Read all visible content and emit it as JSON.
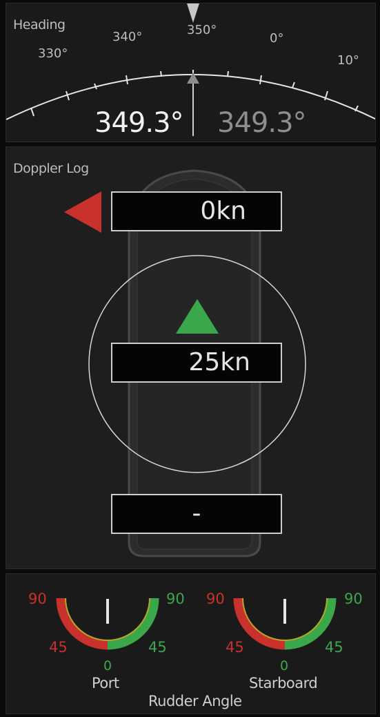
{
  "heading": {
    "title": "Heading",
    "ticks": [
      "330°",
      "340°",
      "350°",
      "0°",
      "10°"
    ],
    "value": "349.3°",
    "secondary_value": "349.3°"
  },
  "doppler": {
    "title": "Doppler Log",
    "transverse_speed": "0kn",
    "longitudinal_speed": "25kn",
    "aft_speed": "-"
  },
  "rudder": {
    "title": "Rudder Angle",
    "port": {
      "label": "Port",
      "left_top": "90",
      "left_mid": "45",
      "right_top": "90",
      "right_mid": "45",
      "bottom": "0"
    },
    "starboard": {
      "label": "Starboard",
      "left_top": "90",
      "left_mid": "45",
      "right_top": "90",
      "right_mid": "45",
      "bottom": "0"
    }
  },
  "colors": {
    "port_red": "#c8312c",
    "starboard_green": "#3aa84a",
    "transition_yellow": "#b8a626"
  }
}
